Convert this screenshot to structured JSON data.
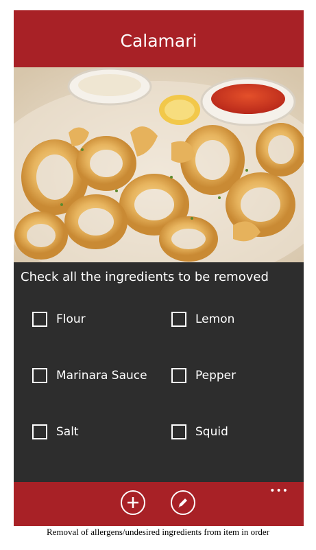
{
  "header": {
    "title": "Calamari"
  },
  "photo": {
    "subject": "calamari-photo"
  },
  "instruction": "Check all the ingredients to be removed",
  "ingredients": [
    {
      "label": "Flour",
      "checked": false
    },
    {
      "label": "Lemon",
      "checked": false
    },
    {
      "label": "Marinara Sauce",
      "checked": false
    },
    {
      "label": "Pepper",
      "checked": false
    },
    {
      "label": "Salt",
      "checked": false
    },
    {
      "label": "Squid",
      "checked": false
    }
  ],
  "appbar": {
    "add_icon": "plus-circle-icon",
    "edit_icon": "pencil-circle-icon",
    "more_label": "•••"
  },
  "caption": "Removal of allergens/undesired ingredients from item in order",
  "colors": {
    "accent": "#a82126",
    "panel": "#2d2d2d",
    "text": "#ffffff"
  }
}
